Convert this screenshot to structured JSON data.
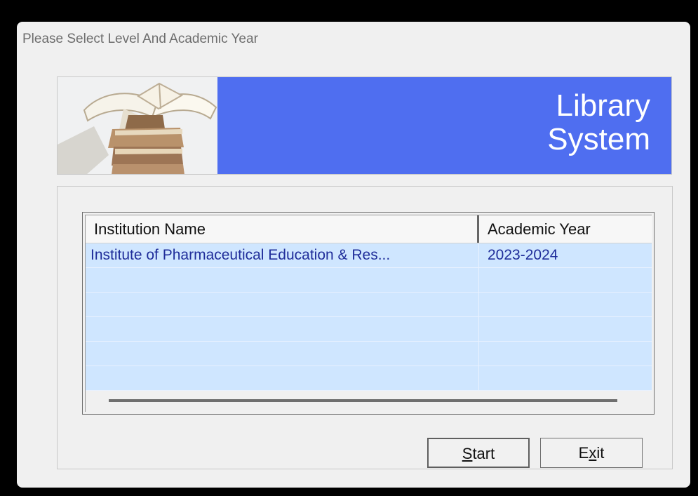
{
  "window": {
    "title": "Please Select Level And Academic Year"
  },
  "banner": {
    "line1": "Library",
    "line2": "System",
    "background": "#4f6ef0"
  },
  "table": {
    "headers": [
      "Institution Name",
      "Academic Year"
    ],
    "rows": [
      [
        "Institute of Pharmaceutical Education & Res...",
        "2023-2024"
      ],
      [
        "",
        ""
      ],
      [
        "",
        ""
      ],
      [
        "",
        ""
      ],
      [
        "",
        ""
      ],
      [
        "",
        ""
      ]
    ]
  },
  "buttons": {
    "start_prefix": "S",
    "start_rest": "tart",
    "exit_prefix": "E",
    "exit_underlined": "x",
    "exit_rest": "it"
  },
  "icons": {
    "books": "books-image"
  },
  "colors": {
    "accent": "#4f6ef0",
    "row_fill": "#cfe6ff",
    "row_text": "#1f2d9a"
  }
}
